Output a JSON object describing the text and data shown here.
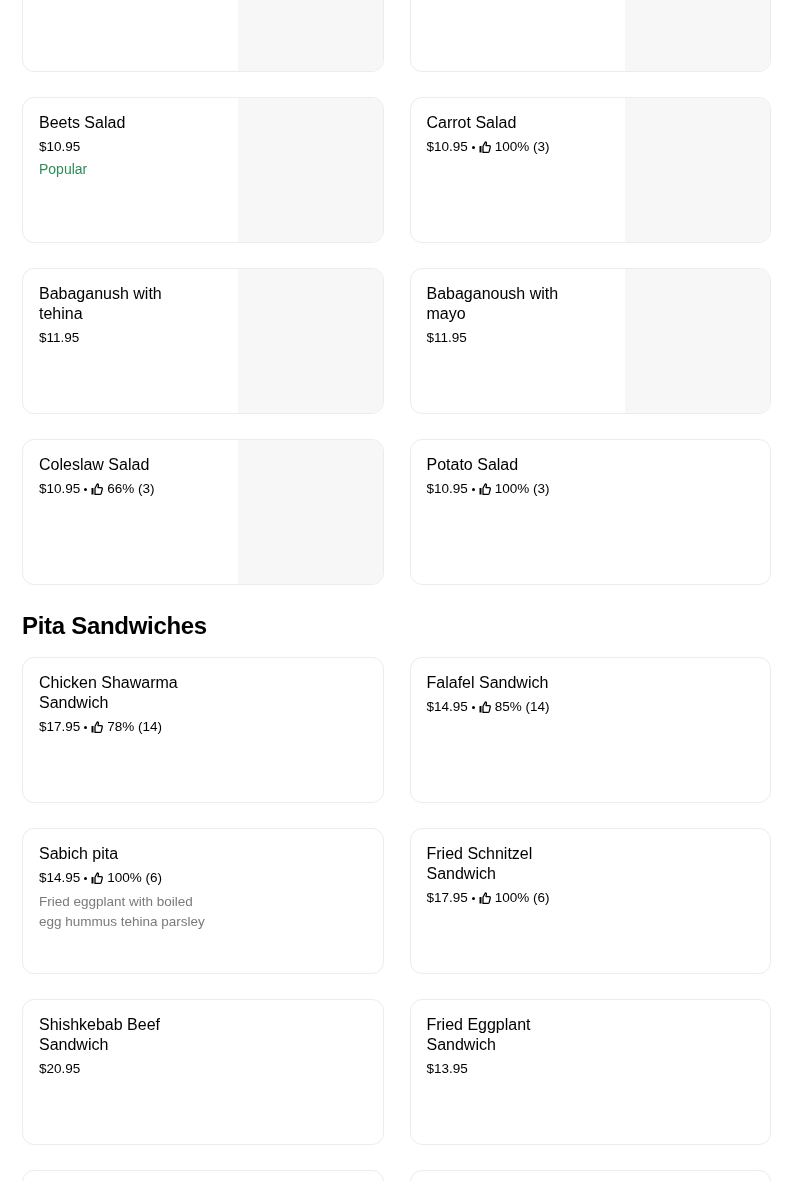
{
  "sections": [
    {
      "items": [
        {
          "has_image": true
        },
        {
          "has_image": true
        },
        {
          "name": "Beets Salad",
          "price": "$10.95",
          "badge": "Popular",
          "has_image": true
        },
        {
          "name": "Carrot Salad",
          "price": "$10.95",
          "rating": "100% (3)",
          "has_image": true
        },
        {
          "name": "Babaganush with tehina",
          "price": "$11.95",
          "has_image": true
        },
        {
          "name": "Babaganoush with mayo",
          "price": "$11.95",
          "has_image": true
        },
        {
          "name": "Coleslaw Salad",
          "price": "$10.95",
          "rating": "66% (3)",
          "has_image": true
        },
        {
          "name": "Potato Salad",
          "price": "$10.95",
          "rating": "100% (3)",
          "has_image": false
        }
      ]
    },
    {
      "title": "Pita Sandwiches",
      "items": [
        {
          "name": "Chicken Shawarma Sandwich",
          "price": "$17.95",
          "rating": "78% (14)",
          "has_image": false
        },
        {
          "name": "Falafel Sandwich",
          "price": "$14.95",
          "rating": "85% (14)",
          "has_image": false
        },
        {
          "name": "Sabich pita",
          "price": "$14.95",
          "rating": "100% (6)",
          "description": "Fried eggplant with boiled egg hummus tehina parsley",
          "has_image": false
        },
        {
          "name": "Fried Schnitzel Sandwich",
          "price": "$17.95",
          "rating": "100% (6)",
          "has_image": false
        },
        {
          "name": "Shishkebab Beef Sandwich",
          "price": "$20.95",
          "has_image": false
        },
        {
          "name": "Fried Eggplant Sandwich",
          "price": "$13.95",
          "has_image": false
        },
        {
          "has_image": false
        },
        {
          "has_image": false
        }
      ]
    }
  ]
}
